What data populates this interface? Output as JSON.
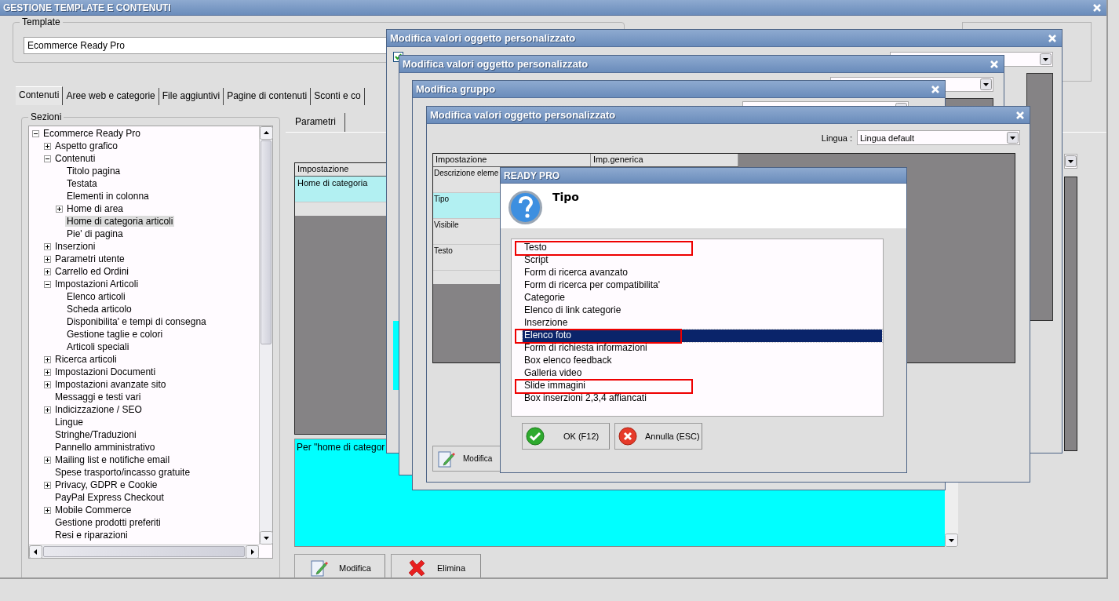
{
  "window": {
    "title": "GESTIONE TEMPLATE E CONTENUTI"
  },
  "template": {
    "label": "Template",
    "value": "Ecommerce Ready Pro"
  },
  "tabs": [
    {
      "label": "Contenuti",
      "selected": true
    },
    {
      "label": "Aree web e categorie",
      "selected": false
    },
    {
      "label": "File aggiuntivi",
      "selected": false
    },
    {
      "label": "Pagine di contenuti",
      "selected": false
    },
    {
      "label": "Sconti e co",
      "selected": false
    }
  ],
  "sections": {
    "label": "Sezioni",
    "tree": [
      {
        "label": "Ecommerce Ready Pro",
        "expanded": true,
        "selected": false,
        "children": [
          {
            "label": "Aspetto grafico",
            "expanded": false,
            "selected": false
          },
          {
            "label": "Contenuti",
            "expanded": true,
            "selected": false,
            "children": [
              {
                "label": "Titolo pagina",
                "selected": false
              },
              {
                "label": "Testata",
                "selected": false
              },
              {
                "label": "Elementi in colonna",
                "selected": false
              },
              {
                "label": "Home di area",
                "expanded": false,
                "selected": false
              },
              {
                "label": "Home di categoria articoli",
                "selected": true
              },
              {
                "label": "Pie' di pagina",
                "selected": false
              }
            ]
          },
          {
            "label": "Inserzioni",
            "expanded": false,
            "selected": false
          },
          {
            "label": "Parametri utente",
            "expanded": false,
            "selected": false
          },
          {
            "label": "Carrello ed Ordini",
            "expanded": false,
            "selected": false
          },
          {
            "label": "Impostazioni Articoli",
            "expanded": true,
            "selected": false,
            "children": [
              {
                "label": "Elenco articoli",
                "selected": false
              },
              {
                "label": "Scheda articolo",
                "selected": false
              },
              {
                "label": "Disponibilita' e tempi di consegna",
                "selected": false
              },
              {
                "label": "Gestione taglie e colori",
                "selected": false
              },
              {
                "label": "Articoli speciali",
                "selected": false
              }
            ]
          },
          {
            "label": "Ricerca articoli",
            "expanded": false,
            "selected": false
          },
          {
            "label": "Impostazioni Documenti",
            "expanded": false,
            "selected": false
          },
          {
            "label": "Impostazioni avanzate sito",
            "expanded": false,
            "selected": false
          },
          {
            "label": "Messaggi e testi vari",
            "selected": false
          },
          {
            "label": "Indicizzazione / SEO",
            "expanded": false,
            "selected": false
          },
          {
            "label": "Lingue",
            "selected": false
          },
          {
            "label": "Stringhe/Traduzioni",
            "selected": false
          },
          {
            "label": "Pannello amministrativo",
            "selected": false
          },
          {
            "label": "Mailing list e notifiche email",
            "expanded": false,
            "selected": false
          },
          {
            "label": "Spese trasporto/incasso gratuite",
            "selected": false
          },
          {
            "label": "Privacy, GDPR e Cookie",
            "expanded": false,
            "selected": false
          },
          {
            "label": "PayPal Express Checkout",
            "selected": false
          },
          {
            "label": "Mobile Commerce",
            "expanded": false,
            "selected": false
          },
          {
            "label": "Gestione prodotti preferiti",
            "selected": false
          },
          {
            "label": "Resi e riparazioni",
            "selected": false
          }
        ]
      }
    ]
  },
  "parameters": {
    "tab": "Parametri",
    "columns": [
      "Impostazione"
    ],
    "rows": [
      {
        "cells": [
          "Home di categoria"
        ],
        "selected": true
      }
    ],
    "description": "Per \"home di categor",
    "buttons": [
      {
        "label": "Modifica",
        "kind": "edit"
      },
      {
        "label": "Elimina",
        "kind": "delete"
      }
    ]
  },
  "dialogs": [
    {
      "title": "Modifica valori oggetto personalizzato",
      "checked": true
    },
    {
      "title": "Modifica valori oggetto personalizzato"
    },
    {
      "title": "Modifica gruppo"
    },
    {
      "title": "Modifica valori oggetto personalizzato",
      "language_label": "Lingua :",
      "language": "Lingua default",
      "columns": [
        "Impostazione",
        "Imp.generica"
      ],
      "rows": [
        {
          "cells": [
            "Descrizione eleme"
          ],
          "selected": false
        },
        {
          "cells": [
            "Tipo"
          ],
          "selected": true
        },
        {
          "cells": [
            "Visibile"
          ],
          "selected": false
        },
        {
          "cells": [
            "Testo"
          ],
          "selected": false
        }
      ],
      "button": "Modifica"
    }
  ],
  "prompt": {
    "title": "READY PRO",
    "heading": "Tipo",
    "options": [
      {
        "label": "Testo",
        "selected": false,
        "marked": true
      },
      {
        "label": "Script",
        "selected": false,
        "marked": false
      },
      {
        "label": "Form di ricerca avanzato",
        "selected": false,
        "marked": false
      },
      {
        "label": "Form di ricerca per compatibilita'",
        "selected": false,
        "marked": false
      },
      {
        "label": "Categorie",
        "selected": false,
        "marked": false
      },
      {
        "label": "Elenco di link categorie",
        "selected": false,
        "marked": false
      },
      {
        "label": "Inserzione",
        "selected": false,
        "marked": false
      },
      {
        "label": "Elenco foto",
        "selected": true,
        "marked": true
      },
      {
        "label": "Form di richiesta informazioni",
        "selected": false,
        "marked": false
      },
      {
        "label": "Box elenco feedback",
        "selected": false,
        "marked": false
      },
      {
        "label": "Galleria video",
        "selected": false,
        "marked": false
      },
      {
        "label": "Slide immagini",
        "selected": false,
        "marked": true
      },
      {
        "label": "Box inserzioni 2,3,4 affiancati",
        "selected": false,
        "marked": false
      }
    ],
    "buttons": [
      {
        "label": "OK (F12)",
        "kind": "ok"
      },
      {
        "label": "Annulla (ESC)",
        "kind": "cancel"
      }
    ]
  }
}
